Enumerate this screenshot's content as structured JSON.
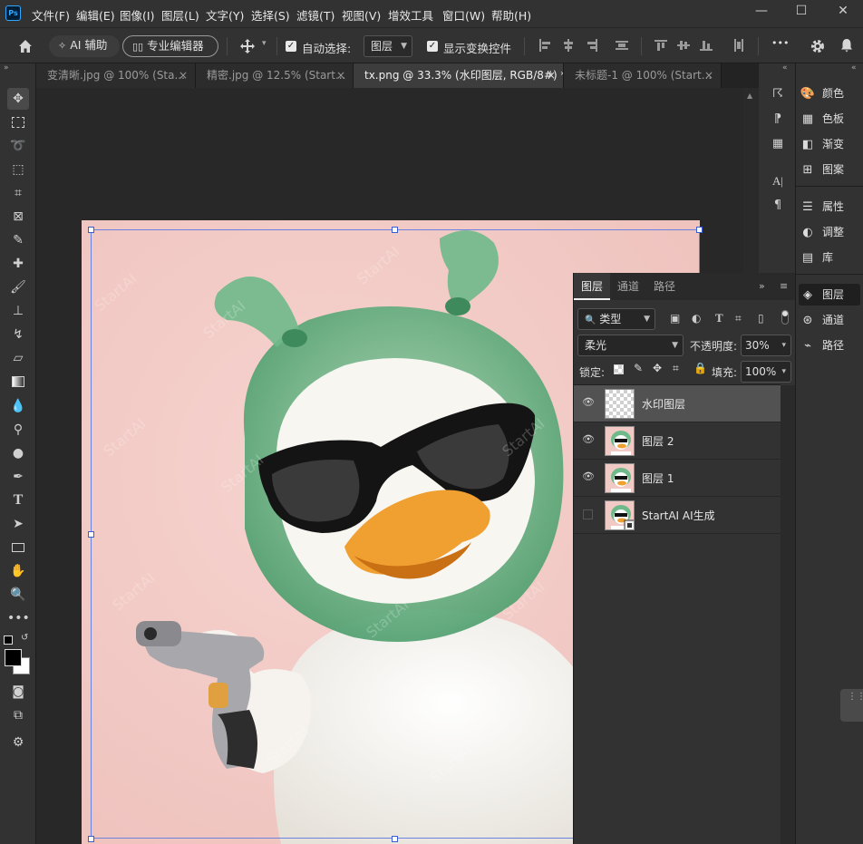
{
  "app": {
    "logo": "Ps"
  },
  "menu": [
    "文件(F)",
    "编辑(E)",
    "图像(I)",
    "图层(L)",
    "文字(Y)",
    "选择(S)",
    "滤镜(T)",
    "视图(V)",
    "增效工具",
    "窗口(W)",
    "帮助(H)"
  ],
  "window_controls": {
    "minimize": "—",
    "maximize": "☐",
    "close": "✕"
  },
  "options": {
    "ai_assist": "AI 辅助",
    "pro_editor": "专业编辑器",
    "auto_select_label": "自动选择:",
    "auto_select_value": "图层",
    "show_transform": "显示变换控件",
    "more": "•••"
  },
  "tabs": [
    {
      "label": "变清晰.jpg @ 100% (Sta...",
      "active": false
    },
    {
      "label": "精密.jpg @ 12.5% (Start...",
      "active": false
    },
    {
      "label": "tx.png @ 33.3% (水印图层, RGB/8#) *",
      "active": true
    },
    {
      "label": "未标题-1 @ 100% (Start...",
      "active": false
    }
  ],
  "right_panels": {
    "group1": [
      "颜色",
      "色板",
      "渐变",
      "图案"
    ],
    "group2": [
      "属性",
      "调整",
      "库"
    ],
    "group3": [
      "图层",
      "通道",
      "路径"
    ]
  },
  "layers_panel": {
    "tabs": [
      "图层",
      "通道",
      "路径"
    ],
    "filter_kind": "类型",
    "blend_mode": "柔光",
    "opacity_label": "不透明度:",
    "opacity_value": "30%",
    "lock_label": "锁定:",
    "fill_label": "填充:",
    "fill_value": "100%",
    "layers": [
      {
        "name": "水印图层",
        "visible": true,
        "selected": true
      },
      {
        "name": "图层 2",
        "visible": true,
        "selected": false
      },
      {
        "name": "图层 1",
        "visible": true,
        "selected": false
      },
      {
        "name": "StartAI AI生成",
        "visible": false,
        "selected": false
      }
    ]
  },
  "watermark_text": "StartAI",
  "colors": {
    "accent": "#31a8ff",
    "canvas_bg": "#f1c9c5",
    "bag_green": "#6fb98a",
    "beak": "#f0a030"
  }
}
